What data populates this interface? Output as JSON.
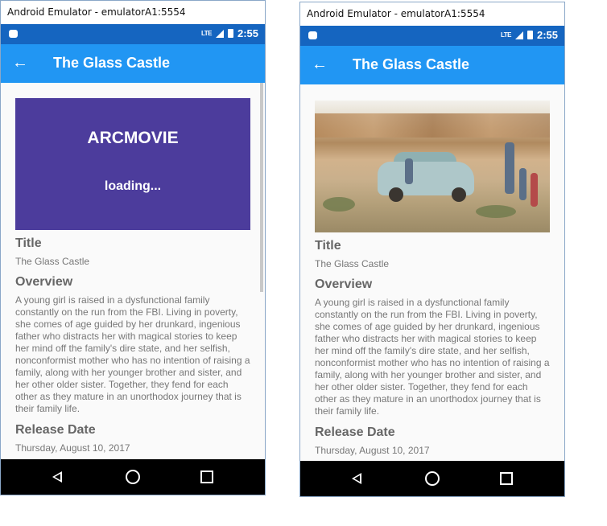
{
  "emulator_title": "Android Emulator - emulatorA1:5554",
  "status_bar": {
    "network": "LTE",
    "time": "2:55",
    "color": "#1565c0"
  },
  "app_bar": {
    "title": "The Glass Castle",
    "color": "#2196f3",
    "back_icon": "arrow-left-icon"
  },
  "poster_loading": {
    "brand": "ARCMOVIE",
    "text": "loading..."
  },
  "movie": {
    "title_label": "Title",
    "title": "The Glass Castle",
    "overview_label": "Overview",
    "overview": "A young girl is raised in a dysfunctional family constantly on the run from the FBI. Living in poverty, she comes of age guided by her drunkard, ingenious father who distracts her with magical stories to keep her mind off the family's dire state, and her selfish, nonconformist mother who has no intention of raising a family, along with her younger brother and sister, and her other older sister. Together, they fend for each other as they mature in an unorthodox journey that is their family life.",
    "release_label": "Release Date",
    "release_date": "Thursday, August 10, 2017"
  },
  "nav_bar": {
    "icons": [
      "back-triangle-icon",
      "home-circle-icon",
      "recents-square-icon"
    ]
  }
}
